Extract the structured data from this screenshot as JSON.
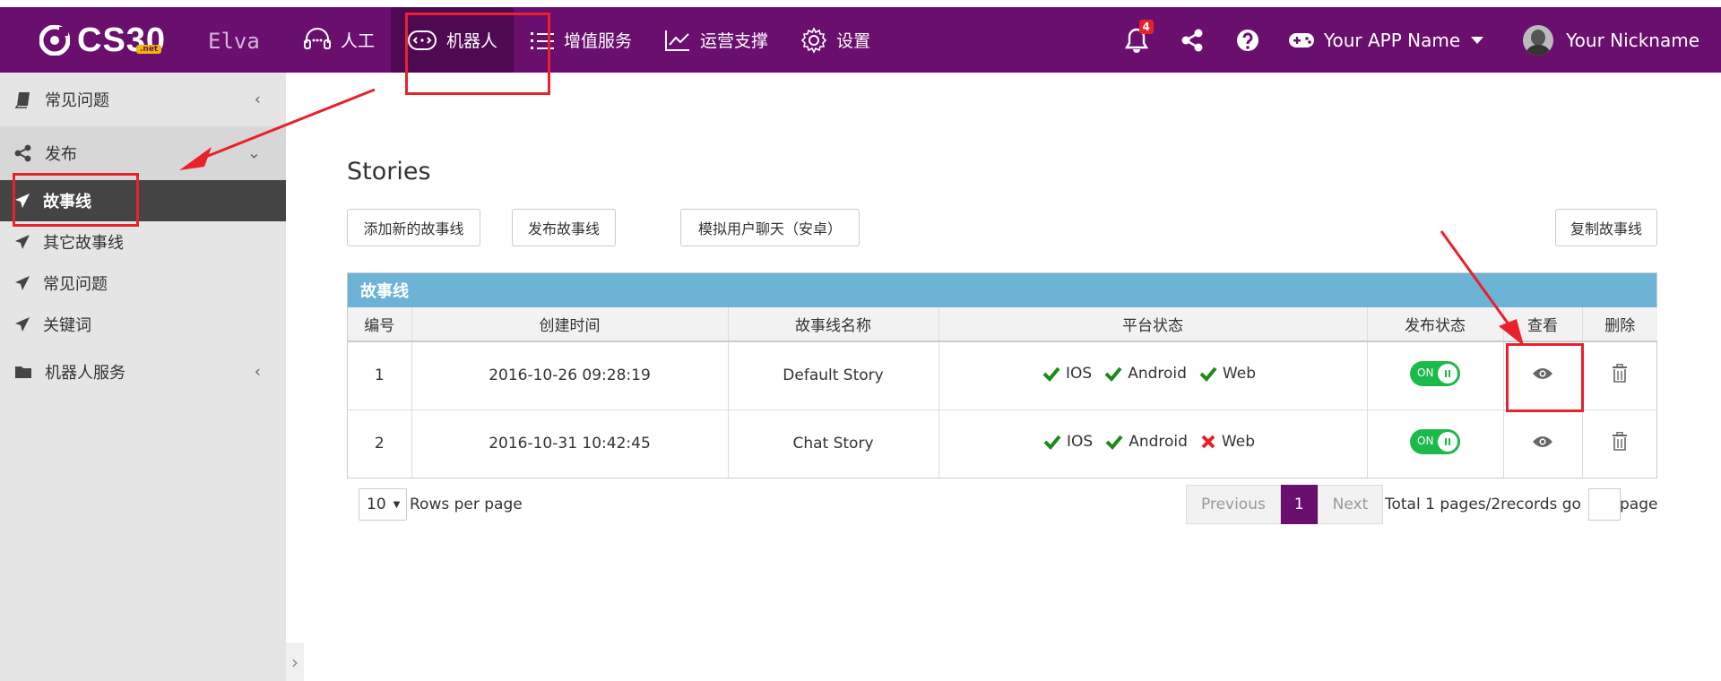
{
  "brand": {
    "logo": "CS30",
    "logo_suffix": ".net",
    "user": "Elva"
  },
  "nav": [
    {
      "id": "human",
      "label": "人工",
      "icon": "headset-icon"
    },
    {
      "id": "robot",
      "label": "机器人",
      "icon": "robot-icon",
      "active": true
    },
    {
      "id": "value",
      "label": "增值服务",
      "icon": "list-icon"
    },
    {
      "id": "ops",
      "label": "运营支撑",
      "icon": "chart-icon"
    },
    {
      "id": "settings",
      "label": "设置",
      "icon": "gear-icon"
    }
  ],
  "topright": {
    "notifications": "4",
    "app_name": "Your APP Name",
    "nickname": "Your Nickname"
  },
  "sidebar": {
    "faq": "常见问题",
    "publish": "发布",
    "sub": [
      "故事线",
      "其它故事线",
      "常见问题",
      "关键词"
    ],
    "robot_service": "机器人服务"
  },
  "main": {
    "title": "Stories",
    "buttons": {
      "add": "添加新的故事线",
      "publish": "发布故事线",
      "simulate": "模拟用户聊天（安卓）",
      "copy": "复制故事线"
    },
    "table": {
      "caption": "故事线",
      "headers": [
        "编号",
        "创建时间",
        "故事线名称",
        "平台状态",
        "发布状态",
        "查看",
        "删除"
      ],
      "rows": [
        {
          "id": "1",
          "created": "2016-10-26 09:28:19",
          "name": "Default Story",
          "platforms": [
            {
              "label": "IOS",
              "ok": true
            },
            {
              "label": "Android",
              "ok": true
            },
            {
              "label": "Web",
              "ok": true
            }
          ],
          "status": "ON"
        },
        {
          "id": "2",
          "created": "2016-10-31 10:42:45",
          "name": "Chat Story",
          "platforms": [
            {
              "label": "IOS",
              "ok": true
            },
            {
              "label": "Android",
              "ok": true
            },
            {
              "label": "Web",
              "ok": false
            }
          ],
          "status": "ON"
        }
      ]
    },
    "footer": {
      "rows_value": "10",
      "rows_label": "Rows per page",
      "previous": "Previous",
      "page": "1",
      "next": "Next",
      "info": "Total 1 pages/2records go",
      "page_label": "page"
    }
  },
  "colors": {
    "topbar": "#6a0f6e",
    "accent_blue": "#6cb3d6",
    "toggle_on": "#1bbb4b",
    "annotation": "#e8212b"
  }
}
